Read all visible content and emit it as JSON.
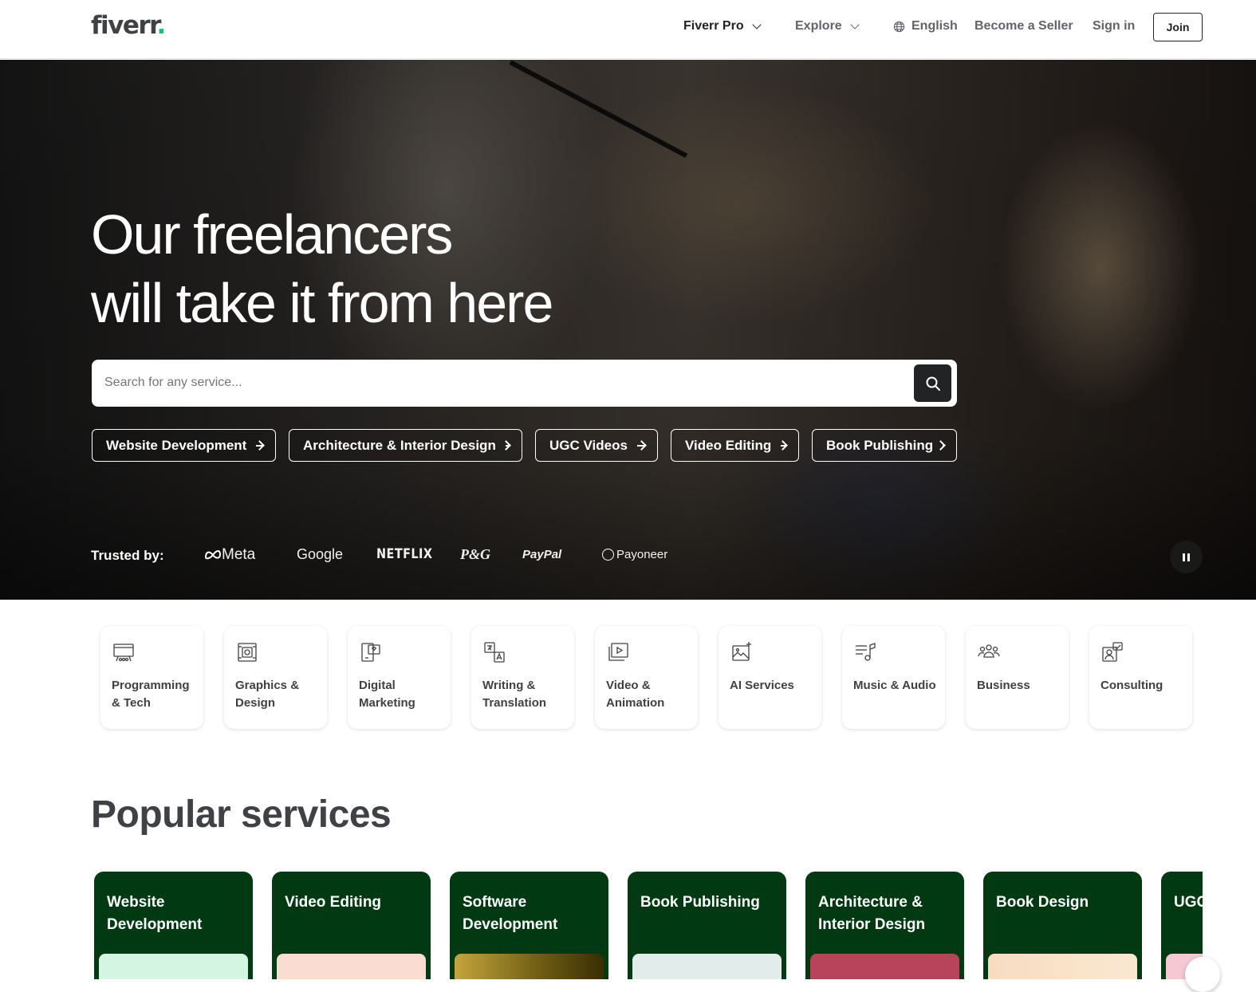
{
  "header": {
    "logo": "fiverr",
    "logo_dot": ".",
    "nav": {
      "fiverr_pro": "Fiverr Pro",
      "explore": "Explore",
      "language": "English",
      "become_seller": "Become a Seller",
      "sign_in": "Sign in",
      "join": "Join"
    }
  },
  "hero": {
    "title_line1": "Our freelancers",
    "title_line2": "will take it from here",
    "search_placeholder": "Search for any service...",
    "pills": [
      {
        "label": "Website Development"
      },
      {
        "label": "Architecture & Interior Design"
      },
      {
        "label": "UGC Videos"
      },
      {
        "label": "Video Editing"
      },
      {
        "label": "Book Publishing"
      }
    ],
    "trusted_label": "Trusted by:",
    "brands": {
      "meta": "Meta",
      "google": "Google",
      "netflix": "NETFLIX",
      "pg": "P&G",
      "paypal": "PayPal",
      "payoneer": "Payoneer"
    }
  },
  "categories": [
    {
      "line1": "Programming",
      "line2": "& Tech",
      "icon": "programming-icon"
    },
    {
      "line1": "Graphics &",
      "line2": "Design",
      "icon": "graphics-icon"
    },
    {
      "line1": "Digital",
      "line2": "Marketing",
      "icon": "marketing-icon"
    },
    {
      "line1": "Writing &",
      "line2": "Translation",
      "icon": "translation-icon"
    },
    {
      "line1": "Video &",
      "line2": "Animation",
      "icon": "video-icon"
    },
    {
      "line1": "AI Services",
      "line2": "",
      "icon": "ai-icon"
    },
    {
      "line1": "Music & Audio",
      "line2": "",
      "icon": "music-icon"
    },
    {
      "line1": "Business",
      "line2": "",
      "icon": "business-icon"
    },
    {
      "line1": "Consulting",
      "line2": "",
      "icon": "consulting-icon"
    }
  ],
  "popular": {
    "title": "Popular services",
    "services": [
      {
        "line1": "Website",
        "line2": "Development",
        "image_color": "#d5f5e3"
      },
      {
        "line1": "Video Editing",
        "line2": "",
        "image_color": "#fbdcd0"
      },
      {
        "line1": "Software",
        "line2": "Development",
        "image_color": "#8a7420"
      },
      {
        "line1": "Book Publishing",
        "line2": "",
        "image_color": "#e2ecea"
      },
      {
        "line1": "Architecture &",
        "line2": "Interior Design",
        "image_color": "#b8445c"
      },
      {
        "line1": "Book Design",
        "line2": "",
        "image_color": "#f7dcc0"
      },
      {
        "line1": "UGC",
        "line2": "",
        "image_color": "#f5c8d4"
      }
    ]
  },
  "colors": {
    "brand_green": "#1dbf73",
    "service_card_bg": "#003912",
    "text_dark": "#404145"
  }
}
